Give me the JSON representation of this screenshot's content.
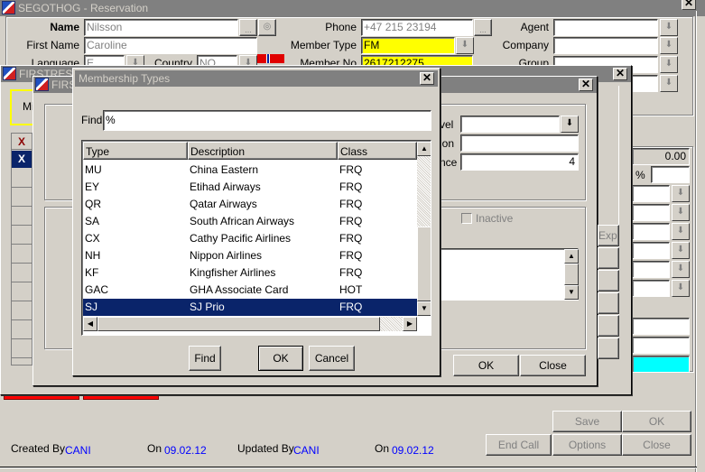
{
  "main_window": {
    "title": "SEGOTHOG - Reservation",
    "fields": {
      "name": {
        "label": "Name",
        "value": "Nilsson"
      },
      "first_name": {
        "label": "First Name",
        "value": "Caroline"
      },
      "language": {
        "label": "Language",
        "value": "E"
      },
      "country": {
        "label": "Country",
        "value": "NO"
      },
      "phone": {
        "label": "Phone",
        "value": "+47 215 23194"
      },
      "member_type": {
        "label": "Member Type",
        "value": "FM"
      },
      "member_no": {
        "label": "Member No",
        "value": "2617212275"
      },
      "agent": {
        "label": "Agent",
        "value": ""
      },
      "company": {
        "label": "Company",
        "value": ""
      },
      "group": {
        "label": "Group",
        "value": ""
      },
      "source": {
        "value": ""
      }
    },
    "right_panel": {
      "amount": "0.00",
      "percent_label": "%",
      "percent_value": ""
    },
    "footer": {
      "created_by_label": "Created By",
      "created_by": "CANI",
      "created_on_label": "On",
      "created_on": "09.02.12",
      "updated_by_label": "Updated By",
      "updated_by": "CANI",
      "updated_on_label": "On",
      "updated_on": "09.02.12"
    },
    "buttons": {
      "save": "Save",
      "ok": "OK",
      "end_call": "End Call",
      "options": "Options",
      "close": "Close"
    }
  },
  "firstres_window_1": {
    "title": "FIRSTRES",
    "tab_label": "Mi",
    "grid_marks": [
      "X",
      "X"
    ]
  },
  "firstres_window_2": {
    "title": "FIRS",
    "labels": {
      "level": "vel",
      "description": "ion",
      "sequence": "nce"
    },
    "sequence_value": "4",
    "inactive_label": "Inactive",
    "side_button_label": "Exp",
    "ok_label": "OK",
    "close_label": "Close"
  },
  "membership_dialog": {
    "title": "Membership Types",
    "find_label": "Find",
    "find_value": "%",
    "columns": [
      "Type",
      "Description",
      "Class"
    ],
    "rows": [
      {
        "type": "MU",
        "description": "China Eastern",
        "class": "FRQ"
      },
      {
        "type": "EY",
        "description": "Etihad Airways",
        "class": "FRQ"
      },
      {
        "type": "QR",
        "description": "Qatar Airways",
        "class": "FRQ"
      },
      {
        "type": "SA",
        "description": "South African Airways",
        "class": "FRQ"
      },
      {
        "type": "CX",
        "description": "Cathy Pacific Airlines",
        "class": "FRQ"
      },
      {
        "type": "NH",
        "description": "Nippon Airlines",
        "class": "FRQ"
      },
      {
        "type": "KF",
        "description": "Kingfisher Airlines",
        "class": "FRQ"
      },
      {
        "type": "GAC",
        "description": "GHA Associate Card",
        "class": "HOT"
      },
      {
        "type": "SJ",
        "description": "SJ Prio",
        "class": "FRQ"
      }
    ],
    "selected_index": 8,
    "buttons": {
      "find": "Find",
      "ok": "OK",
      "cancel": "Cancel"
    }
  }
}
